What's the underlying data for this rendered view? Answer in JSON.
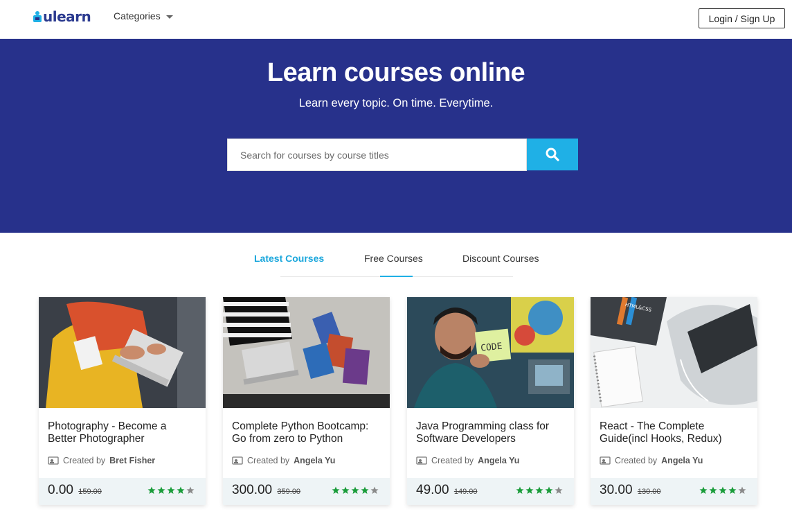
{
  "header": {
    "logo_text": "ulearn",
    "categories_label": "Categories",
    "login_label": "Login / Sign Up"
  },
  "hero": {
    "title": "Learn courses online",
    "subtitle": "Learn every topic. On time. Everytime.",
    "search_placeholder": "Search for courses by course titles"
  },
  "tabs": [
    {
      "label": "Latest Courses",
      "active": true
    },
    {
      "label": "Free Courses",
      "active": false
    },
    {
      "label": "Discount Courses",
      "active": false
    }
  ],
  "courses": [
    {
      "title": "Photography - Become a Better Photographer",
      "created_by_label": "Created by",
      "author": "Bret Fisher",
      "price": "0.00",
      "old_price": "159.00",
      "rating": 4
    },
    {
      "title": "Complete Python Bootcamp: Go from zero to Python",
      "created_by_label": "Created by",
      "author": "Angela Yu",
      "price": "300.00",
      "old_price": "359.00",
      "rating": 4
    },
    {
      "title": "Java Programming class for Software Developers",
      "created_by_label": "Created by",
      "author": "Angela Yu",
      "price": "49.00",
      "old_price": "149.00",
      "rating": 4
    },
    {
      "title": "React - The Complete Guide(incl Hooks, Redux)",
      "created_by_label": "Created by",
      "author": "Angela Yu",
      "price": "30.00",
      "old_price": "130.00",
      "rating": 4
    }
  ],
  "colors": {
    "brand": "#27318b",
    "accent": "#1fb0e6",
    "star_filled": "#1a9c3a",
    "star_empty": "#8a8a8a"
  }
}
